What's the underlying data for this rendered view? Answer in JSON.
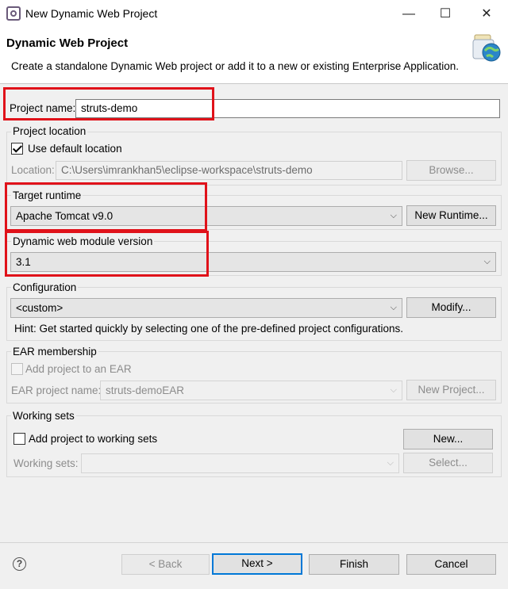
{
  "window": {
    "title": "New Dynamic Web Project"
  },
  "header": {
    "title": "Dynamic Web Project",
    "description": "Create a standalone Dynamic Web project or add it to a new or existing Enterprise Application."
  },
  "project_name": {
    "label": "Project name:",
    "value": "struts-demo"
  },
  "project_location": {
    "group_label": "Project location",
    "use_default_label": "Use default location",
    "use_default_checked": true,
    "location_label": "Location:",
    "location_value": "C:\\Users\\imrankhan5\\eclipse-workspace\\struts-demo",
    "browse_label": "Browse..."
  },
  "target_runtime": {
    "group_label": "Target runtime",
    "value": "Apache Tomcat v9.0",
    "new_runtime_label": "New Runtime..."
  },
  "module_version": {
    "group_label": "Dynamic web module version",
    "value": "3.1"
  },
  "configuration": {
    "group_label": "Configuration",
    "value": "<custom>",
    "modify_label": "Modify...",
    "hint": "Hint: Get started quickly by selecting one of the pre-defined project configurations."
  },
  "ear": {
    "group_label": "EAR membership",
    "add_label": "Add project to an EAR",
    "name_label": "EAR project name:",
    "name_value": "struts-demoEAR",
    "new_project_label": "New Project..."
  },
  "working_sets": {
    "group_label": "Working sets",
    "add_label": "Add project to working sets",
    "new_label": "New...",
    "sets_label": "Working sets:",
    "sets_value": "",
    "select_label": "Select..."
  },
  "footer": {
    "help_glyph": "?",
    "back_label": "< Back",
    "next_label": "Next >",
    "finish_label": "Finish",
    "cancel_label": "Cancel"
  },
  "icons": {
    "minimize": "minimize-icon",
    "maximize": "maximize-icon",
    "close": "close-icon",
    "dropdown": "chevron-down-icon"
  },
  "colors": {
    "highlight": "#e0121a",
    "default_button_border": "#0078d7"
  }
}
